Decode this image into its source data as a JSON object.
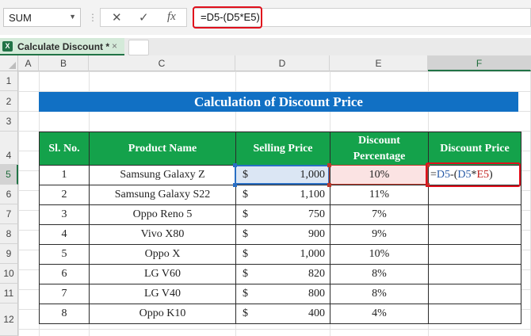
{
  "formula_bar": {
    "name_box": "SUM",
    "cancel_icon": "✕",
    "enter_icon": "✓",
    "fx_icon": "fx",
    "formula": "=D5-(D5*E5)"
  },
  "workbook_tab": {
    "label": "Calculate Discount *",
    "close": "×",
    "app_icon": "X"
  },
  "columns": [
    "A",
    "B",
    "C",
    "D",
    "E",
    "F"
  ],
  "rows": [
    "1",
    "2",
    "3",
    "4",
    "5",
    "6",
    "7",
    "8",
    "9",
    "10",
    "11",
    "12"
  ],
  "title": "Calculation of Discount Price",
  "table": {
    "headers": {
      "sl": "Sl. No.",
      "product": "Product Name",
      "selling": "Selling Price",
      "discount_l1": "Discount",
      "discount_l2": "Percentage",
      "final": "Discount Price"
    },
    "currency": "$",
    "rows": [
      {
        "sl": "1",
        "product": "Samsung Galaxy Z",
        "price": "1,000",
        "discount": "10%"
      },
      {
        "sl": "2",
        "product": "Samsung Galaxy S22",
        "price": "1,100",
        "discount": "11%"
      },
      {
        "sl": "3",
        "product": "Oppo Reno 5",
        "price": "750",
        "discount": "7%"
      },
      {
        "sl": "4",
        "product": "Vivo X80",
        "price": "900",
        "discount": "9%"
      },
      {
        "sl": "5",
        "product": "Oppo X",
        "price": "1,000",
        "discount": "10%"
      },
      {
        "sl": "6",
        "product": "LG V60",
        "price": "820",
        "discount": "8%"
      },
      {
        "sl": "7",
        "product": "LG V40",
        "price": "800",
        "discount": "8%"
      },
      {
        "sl": "8",
        "product": "Oppo K10",
        "price": "400",
        "discount": "4%"
      }
    ],
    "edit_cell": {
      "eq": "=",
      "ref1": "D5",
      "op1": "-(",
      "ref2": "D5",
      "op2": "*",
      "ref3": "E5",
      "close": ")"
    }
  },
  "colors": {
    "title_bg": "#1170C4",
    "header_bg": "#14A24B",
    "highlight": "#E0101C"
  }
}
